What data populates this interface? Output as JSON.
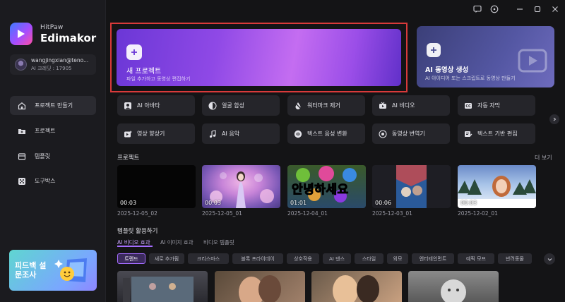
{
  "app": {
    "brand_top": "HitPaw",
    "brand_name": "Edimakor"
  },
  "account": {
    "email": "wangjingxian@teno...",
    "credits": "AI 크레딧 : 17905"
  },
  "nav": [
    {
      "label": "프로젝트 만들기",
      "icon": "home-icon",
      "active": true
    },
    {
      "label": "프로젝트",
      "icon": "folder-icon"
    },
    {
      "label": "템플릿",
      "icon": "template-icon"
    },
    {
      "label": "도구박스",
      "icon": "toolbox-icon"
    }
  ],
  "survey_banner": {
    "text": "피드백 설문조사"
  },
  "hero": {
    "new_project": {
      "title": "새 프로젝트",
      "subtitle": "파일 추가하고 동영상 편집하기"
    },
    "ai_video": {
      "title": "AI 동영상 생성",
      "subtitle": "AI 아이디어 또는 스크립트로 동영상 만들기"
    }
  },
  "features": [
    {
      "label": "AI 아바타",
      "icon": "avatar-icon"
    },
    {
      "label": "얼굴 합성",
      "icon": "face-swap-icon"
    },
    {
      "label": "워터마크 제거",
      "icon": "watermark-remove-icon"
    },
    {
      "label": "AI 비디오",
      "icon": "ai-video-icon"
    },
    {
      "label": "자동 자막",
      "icon": "caption-icon"
    },
    {
      "label": "영상 향상기",
      "icon": "video-enhance-icon"
    },
    {
      "label": "AI 음악",
      "icon": "music-icon"
    },
    {
      "label": "텍스트 음성 변환",
      "icon": "tts-icon"
    },
    {
      "label": "동영상 번역기",
      "icon": "translate-icon"
    },
    {
      "label": "텍스트 기반 편집",
      "icon": "text-edit-icon"
    }
  ],
  "projects": {
    "title": "프로젝트",
    "more": "더 보기",
    "items": [
      {
        "duration": "00:03",
        "date": "2025-12-05_02"
      },
      {
        "duration": "00:03",
        "date": "2025-12-05_01"
      },
      {
        "duration": "01:01",
        "date": "2025-12-04_01",
        "overlay_text": "안녕하세요"
      },
      {
        "duration": "00:06",
        "date": "2025-12-03_01"
      },
      {
        "duration": "00:03",
        "date": "2025-12-02_01"
      }
    ]
  },
  "templates": {
    "title": "템플릿 활용하기",
    "tabs": [
      "AI 비디오 효과",
      "AI 이미지 효과",
      "비디오 템플릿"
    ],
    "chips": [
      "트렌드",
      "새로 추가됨",
      "크리스마스",
      "블록 프라이데이",
      "상호작용",
      "AI 댄스",
      "스타일",
      "외모",
      "엔터테인먼트",
      "예픽 모프",
      "반려동물"
    ]
  },
  "colors": {
    "accent": "#a46cff",
    "highlight_border": "#d83a3a",
    "background": "#141416"
  }
}
